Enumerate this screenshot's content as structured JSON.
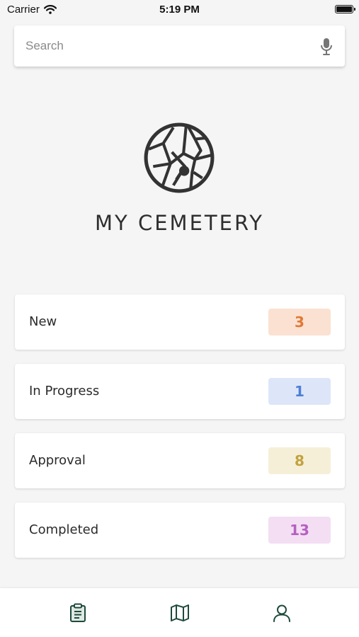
{
  "status_bar": {
    "carrier": "Carrier",
    "time": "5:19 PM"
  },
  "search": {
    "placeholder": "Search"
  },
  "app": {
    "title": "MY CEMETERY"
  },
  "status_cards": [
    {
      "label": "New",
      "count": "3",
      "badge_bg": "#fbe1d2",
      "badge_color": "#e07a37"
    },
    {
      "label": "In Progress",
      "count": "1",
      "badge_bg": "#dde6f8",
      "badge_color": "#4f7fd6"
    },
    {
      "label": "Approval",
      "count": "8",
      "badge_bg": "#f6efd8",
      "badge_color": "#c2a23f"
    },
    {
      "label": "Completed",
      "count": "13",
      "badge_bg": "#f3def3",
      "badge_color": "#b660c2"
    }
  ],
  "tab_bar": {
    "tabs": [
      {
        "icon": "clipboard-icon",
        "active": true
      },
      {
        "icon": "map-icon",
        "active": false
      },
      {
        "icon": "profile-icon",
        "active": false
      }
    ]
  },
  "colors": {
    "background": "#f5f5f5",
    "tab_icon": "#1f4a3d"
  }
}
